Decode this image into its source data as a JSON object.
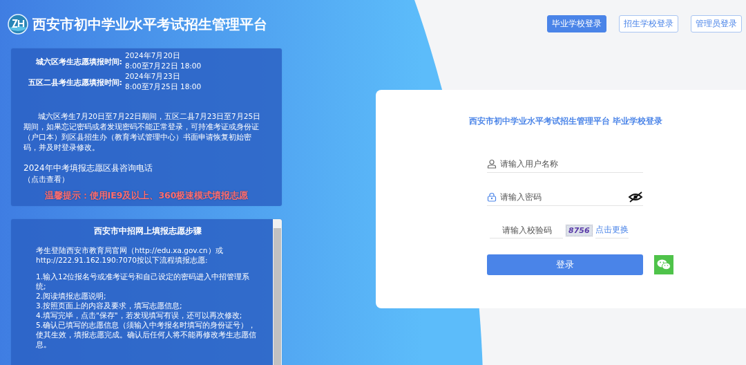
{
  "header": {
    "title": "西安市初中学业水平考试招生管理平台"
  },
  "login_tabs": [
    {
      "label": "毕业学校登录",
      "selected": true
    },
    {
      "label": "招生学校登录",
      "selected": false
    },
    {
      "label": "管理员登录",
      "selected": false
    }
  ],
  "notice": {
    "schedule": [
      {
        "label": "城六区考生志愿填报时间:",
        "value": "2024年7月20日 8:00至7月22日 18:00"
      },
      {
        "label": "五区二县考生志愿填报时间:",
        "value": "2024年7月23日 8:00至7月25日 18:00"
      }
    ],
    "paragraph": "城六区考生7月20日至7月22日期间，五区二县7月23日至7月25日期间，如果忘记密码或者发现密码不能正常登录，可持准考证或身份证（户口本）到区县招生办（教育考试管理中心）书面申请恢复初始密码，并及时登录修改。",
    "hotline": "2024年中考填报志愿区县咨询电话",
    "hotline_hint": "（点击查看）",
    "tip": "温馨提示：使用IE9及以上、360极速模式填报志愿"
  },
  "steps": {
    "title": "西安市中招网上填报志愿步骤",
    "intro": "考生登陆西安市教育局官网（http://edu.xa.gov.cn）或http://222.91.162.190:7070按以下流程填报志愿:",
    "items": [
      "1.输入12位报名号或准考证号和自己设定的密码进入中招管理系统;",
      "2.阅读填报志愿说明;",
      "3.按照页面上的内容及要求，填写志愿信息;",
      "4.填写完毕，点击\"保存\"，若发现填写有误，还可以再次修改;",
      "5.确认已填写的志愿信息（须输入中考报名时填写的身份证号），使其生效，填报志愿完成。确认后任何人将不能再修改考生志愿信息。"
    ]
  },
  "login_form": {
    "title": "西安市初中学业水平考试招生管理平台 毕业学校登录",
    "username": {
      "placeholder": "请输入用户名称"
    },
    "password": {
      "placeholder": "请输入密码"
    },
    "captcha": {
      "placeholder": "请输入校验码",
      "code": "8756",
      "refresh": "点击更换"
    },
    "submit": "登录"
  }
}
